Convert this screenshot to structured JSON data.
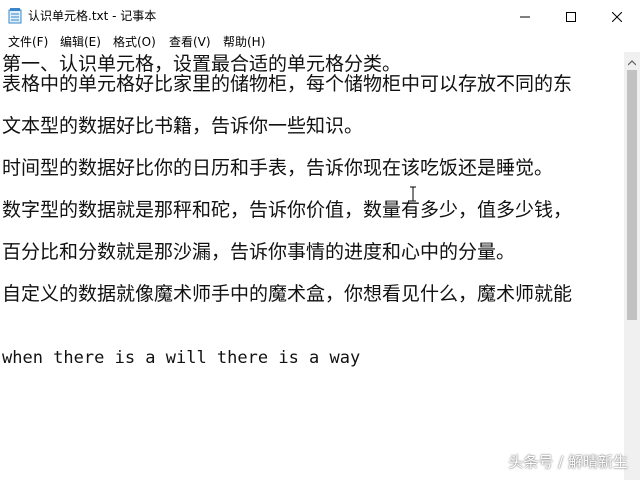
{
  "window": {
    "title": "认识单元格.txt - 记事本",
    "icons": [
      "notepad-icon",
      "minimize-icon",
      "maximize-icon",
      "close-icon"
    ]
  },
  "menu": {
    "file": "文件(F)",
    "edit": "编辑(E)",
    "format": "格式(O)",
    "view": "查看(V)",
    "help": "帮助(H)"
  },
  "content": {
    "lines": [
      "第一、认识单元格，设置最合适的单元格分类。",
      "表格中的单元格好比家里的储物柜，每个储物柜中可以存放不同的东",
      "文本型的数据好比书籍，告诉你一些知识。",
      "时间型的数据好比你的日历和手表，告诉你现在该吃饭还是睡觉。",
      "数字型的数据就是那秤和砣，告诉你价值，数量有多少，值多少钱，",
      "百分比和分数就是那沙漏，告诉你事情的进度和心中的分量。",
      "自定义的数据就像魔术师手中的魔术盒，你想看见什么，魔术师就能",
      "when there is a will there is a way"
    ]
  },
  "watermark": "头条号 / 解晴新生",
  "colors": {
    "background": "#ffffff",
    "scrollbar_track": "#f0f0f0",
    "scrollbar_thumb": "#c2c2c2",
    "text": "#111111"
  }
}
